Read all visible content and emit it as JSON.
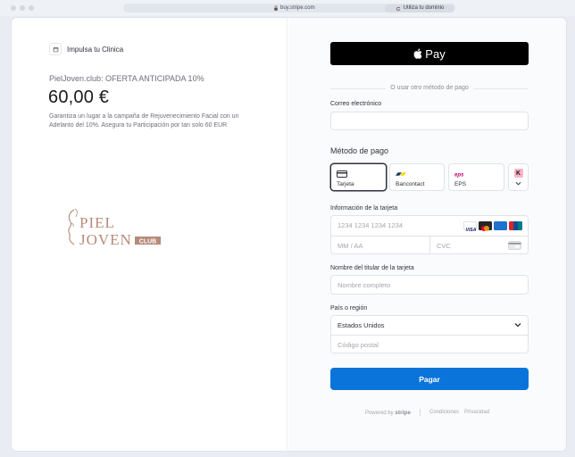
{
  "browser": {
    "url": "buy.stripe.com",
    "domain_button": "Utiliza tu dominio"
  },
  "merchant": {
    "name": "Impulsa tu Clinica"
  },
  "product": {
    "name": "PielJoven.club: OFERTA ANTICIPADA 10%",
    "price": "60,00 €",
    "description": "Garantiza un lugar a la campaña de Rejuvenecimiento Facial con un Adelanto del 10%. Asegura tu Participación por tan solo 60 EUR"
  },
  "logo": {
    "line1": "PIEL",
    "line2": "JOVEN",
    "badge": "CLUB"
  },
  "checkout": {
    "apple_pay_label": "Pay",
    "divider": "O usar otro método de pago",
    "email_label": "Correo electrónico",
    "email_value": "",
    "payment_method_heading": "Método de pago",
    "methods": [
      {
        "label": "Tarjeta"
      },
      {
        "label": "Bancontact"
      },
      {
        "label": "EPS"
      }
    ],
    "more_method_icon": "K",
    "card_info_label": "Información de la tarjeta",
    "card_number_placeholder": "1234 1234 1234 1234",
    "card_expiry_placeholder": "MM / AA",
    "card_cvc_placeholder": "CVC",
    "cardholder_label": "Nombre del titular de la tarjeta",
    "cardholder_placeholder": "Nombre completo",
    "country_label": "País o región",
    "country_value": "Estados Unidos",
    "postal_placeholder": "Código postal",
    "pay_button": "Pagar"
  },
  "footer": {
    "powered_by": "Powered by",
    "brand": "stripe",
    "terms": "Condiciones",
    "privacy": "Privacidad"
  },
  "colors": {
    "pay_button": "#0a74da",
    "apple_pay": "#000000",
    "logo": "#b78a7a"
  }
}
